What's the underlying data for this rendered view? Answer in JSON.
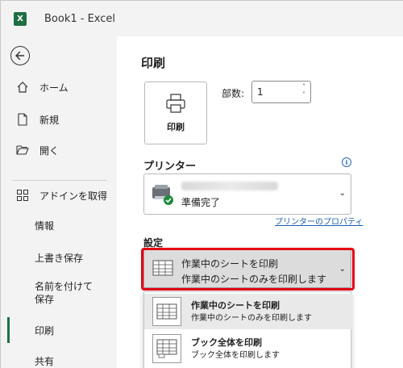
{
  "titlebar": {
    "logo_letter": "X",
    "title": "Book1  -  Excel"
  },
  "sidebar": {
    "items": [
      {
        "label": "ホーム"
      },
      {
        "label": "新規"
      },
      {
        "label": "開く"
      },
      {
        "label": "アドインを取得"
      },
      {
        "label": "情報"
      },
      {
        "label": "上書き保存"
      },
      {
        "label": "名前を付けて保存"
      },
      {
        "label": "印刷"
      },
      {
        "label": "共有"
      }
    ]
  },
  "main": {
    "heading": "印刷",
    "print_button_label": "印刷",
    "copies_label": "部数:",
    "copies_value": "1",
    "printer_heading": "プリンター",
    "info_glyph": "i",
    "printer_status": "準備完了",
    "printer_properties_link": "プリンターのプロパティ",
    "settings_heading": "設定",
    "selected_setting": {
      "title": "作業中のシートを印刷",
      "description": "作業中のシートのみを印刷します"
    },
    "dropdown_options": [
      {
        "title": "作業中のシートを印刷",
        "description": "作業中のシートのみを印刷します"
      },
      {
        "title": "ブック全体を印刷",
        "description": "ブック全体を印刷します"
      }
    ]
  },
  "colors": {
    "excel_green": "#1e7145",
    "highlight_red": "#e60012",
    "link_blue": "#1a5fb4"
  }
}
